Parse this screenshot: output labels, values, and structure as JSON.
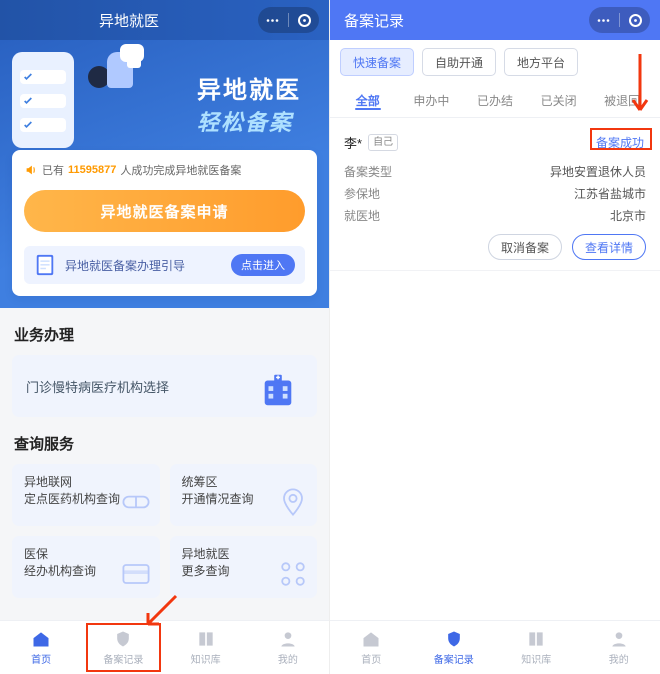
{
  "left": {
    "nav_title": "异地就医",
    "hero_line1": "异地就医",
    "hero_line2": "轻松备案",
    "stat_prefix": "已有",
    "stat_number": "11595877",
    "stat_suffix": "人成功完成异地就医备案",
    "apply_label": "异地就医备案申请",
    "guide_label": "异地就医备案办理引导",
    "enter_label": "点击进入",
    "section_biz": "业务办理",
    "biz_item": "门诊慢特病医疗机构选择",
    "section_query": "查询服务",
    "query": [
      {
        "l1": "异地联网",
        "l2": "定点医药机构查询"
      },
      {
        "l1": "统筹区",
        "l2": "开通情况查询"
      },
      {
        "l1": "医保",
        "l2": "经办机构查询"
      },
      {
        "l1": "异地就医",
        "l2": "更多查询"
      }
    ],
    "tabs": [
      {
        "id": "home",
        "label": "首页"
      },
      {
        "id": "records",
        "label": "备案记录"
      },
      {
        "id": "kb",
        "label": "知识库"
      },
      {
        "id": "me",
        "label": "我的"
      }
    ]
  },
  "right": {
    "nav_title": "备案记录",
    "pills": [
      {
        "label": "快速备案",
        "active": true
      },
      {
        "label": "自助开通",
        "active": false
      },
      {
        "label": "地方平台",
        "active": false
      }
    ],
    "filter_tabs": [
      "全部",
      "申办中",
      "已办结",
      "已关闭",
      "被退回"
    ],
    "filter_active": 0,
    "record": {
      "name": "李*",
      "relation": "自己",
      "status": "备案成功",
      "rows": [
        {
          "k": "备案类型",
          "v": "异地安置退休人员"
        },
        {
          "k": "参保地",
          "v": "江苏省盐城市"
        },
        {
          "k": "就医地",
          "v": "北京市"
        }
      ],
      "actions": {
        "cancel": "取消备案",
        "detail": "查看详情"
      }
    },
    "tabs": [
      {
        "id": "home",
        "label": "首页"
      },
      {
        "id": "records",
        "label": "备案记录"
      },
      {
        "id": "kb",
        "label": "知识库"
      },
      {
        "id": "me",
        "label": "我的"
      }
    ]
  }
}
